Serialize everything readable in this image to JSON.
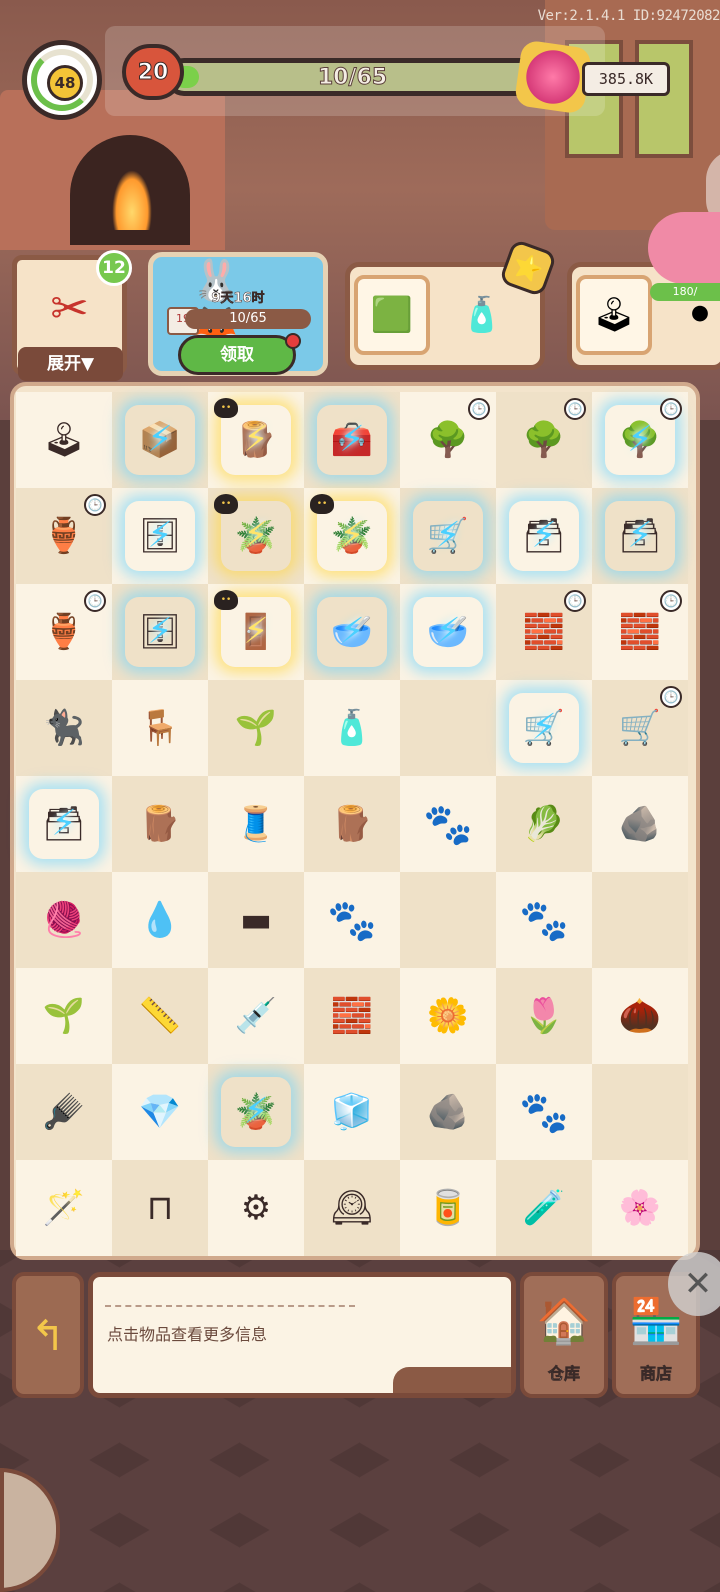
{
  "version_id": "Ver:2.1.4.1 ID:92472082",
  "player": {
    "level": "48",
    "pumpkin_count": "20",
    "xp_text": "10/65",
    "currency": "385.8K",
    "xp_progress": 0.154
  },
  "quest": {
    "badge_count": "12",
    "expand_label": "展开▼"
  },
  "event": {
    "timer": "9天16时",
    "tag": "19",
    "progress_text": "10/65",
    "claim_label": "领取"
  },
  "piggy": {
    "progress_text": "180/"
  },
  "board_rows": [
    [
      {
        "name": "arcade-machine",
        "glyph": "🕹",
        "fx": ""
      },
      {
        "name": "crate-box",
        "glyph": "📦",
        "fx": "energy"
      },
      {
        "name": "wooden-stakes",
        "glyph": "🪵",
        "fx": "gold",
        "cat": "1-13"
      },
      {
        "name": "tool-chest",
        "glyph": "🧰",
        "fx": "energy"
      },
      {
        "name": "bonsai-tree",
        "glyph": "🌳",
        "fx": "",
        "clock": true
      },
      {
        "name": "bonsai-tree",
        "glyph": "🌳",
        "fx": "",
        "clock": true
      },
      {
        "name": "bonsai-tree",
        "glyph": "🌳",
        "fx": "energy",
        "clock": true
      }
    ],
    [
      {
        "name": "blue-vase",
        "glyph": "🏺",
        "fx": "",
        "clock": true
      },
      {
        "name": "glass-cabinet",
        "glyph": "🗄",
        "fx": "energy"
      },
      {
        "name": "plant-pot",
        "glyph": "🪴",
        "fx": "gold",
        "cat": "1-19"
      },
      {
        "name": "plant-pot",
        "glyph": "🪴",
        "fx": "gold",
        "cat": "1-12"
      },
      {
        "name": "mine-cart",
        "glyph": "🛒",
        "fx": "energy"
      },
      {
        "name": "dresser",
        "glyph": "🗃",
        "fx": "energy"
      },
      {
        "name": "dresser-flowers",
        "glyph": "🗃",
        "fx": "energy"
      }
    ],
    [
      {
        "name": "flower-vase",
        "glyph": "🏺",
        "fx": "",
        "clock": true
      },
      {
        "name": "glass-cabinet",
        "glyph": "🗄",
        "fx": "energy"
      },
      {
        "name": "folding-screen",
        "glyph": "🚪",
        "fx": "gold",
        "cat": "1-131"
      },
      {
        "name": "golden-bowl",
        "glyph": "🥣",
        "fx": "energy"
      },
      {
        "name": "glass-bowl",
        "glyph": "🥣",
        "fx": "energy"
      },
      {
        "name": "brick-cart",
        "glyph": "🧱",
        "fx": "",
        "clock": true
      },
      {
        "name": "brick-cart",
        "glyph": "🧱",
        "fx": "",
        "clock": true
      }
    ],
    [
      {
        "name": "black-cat",
        "glyph": "🐈‍⬛",
        "fx": ""
      },
      {
        "name": "side-table",
        "glyph": "🪑",
        "fx": ""
      },
      {
        "name": "berry-plant",
        "glyph": "🌱",
        "fx": ""
      },
      {
        "name": "potion-bottle",
        "glyph": "🧴",
        "fx": ""
      },
      {
        "name": "empty",
        "glyph": "",
        "fx": ""
      },
      {
        "name": "mine-cart",
        "glyph": "🛒",
        "fx": "energy"
      },
      {
        "name": "orange-cart",
        "glyph": "🛒",
        "fx": "",
        "clock": true
      }
    ],
    [
      {
        "name": "drawer-chest",
        "glyph": "🗃",
        "fx": "energy"
      },
      {
        "name": "firewood",
        "glyph": "🪵",
        "fx": ""
      },
      {
        "name": "sewing-kit",
        "glyph": "🧵",
        "fx": ""
      },
      {
        "name": "wood-planks",
        "glyph": "🪵",
        "fx": ""
      },
      {
        "name": "paw-empty",
        "glyph": "🐾",
        "fx": "paw"
      },
      {
        "name": "green-succulent",
        "glyph": "🥬",
        "fx": ""
      },
      {
        "name": "rock",
        "glyph": "🪨",
        "fx": ""
      }
    ],
    [
      {
        "name": "thread-spool",
        "glyph": "🧶",
        "fx": ""
      },
      {
        "name": "dropper-bottle",
        "glyph": "💧",
        "fx": ""
      },
      {
        "name": "iron-bar",
        "glyph": "▬",
        "fx": ""
      },
      {
        "name": "paw-empty",
        "glyph": "🐾",
        "fx": "paw"
      },
      {
        "name": "empty",
        "glyph": "",
        "fx": ""
      },
      {
        "name": "paw-empty",
        "glyph": "🐾",
        "fx": "paw"
      },
      {
        "name": "empty",
        "glyph": "",
        "fx": ""
      }
    ],
    [
      {
        "name": "seedling-box",
        "glyph": "🌱",
        "fx": ""
      },
      {
        "name": "spirit-level",
        "glyph": "📏",
        "fx": ""
      },
      {
        "name": "pipette",
        "glyph": "💉",
        "fx": ""
      },
      {
        "name": "iron-bars",
        "glyph": "🧱",
        "fx": ""
      },
      {
        "name": "blue-flower",
        "glyph": "🌼",
        "fx": ""
      },
      {
        "name": "pink-succulent",
        "glyph": "🌷",
        "fx": ""
      },
      {
        "name": "acorns",
        "glyph": "🌰",
        "fx": ""
      }
    ],
    [
      {
        "name": "comb-tool",
        "glyph": "🪮",
        "fx": ""
      },
      {
        "name": "crystal-sand",
        "glyph": "💎",
        "fx": ""
      },
      {
        "name": "gold-plant-pot",
        "glyph": "🪴",
        "fx": "energy"
      },
      {
        "name": "ice-crystals",
        "glyph": "🧊",
        "fx": ""
      },
      {
        "name": "coal",
        "glyph": "🪨",
        "fx": ""
      },
      {
        "name": "paw-empty",
        "glyph": "🐾",
        "fx": "paw"
      },
      {
        "name": "empty",
        "glyph": "",
        "fx": ""
      }
    ],
    [
      {
        "name": "magic-wand",
        "glyph": "🪄",
        "fx": ""
      },
      {
        "name": "handle",
        "glyph": "⊓",
        "fx": ""
      },
      {
        "name": "button-knob",
        "glyph": "⚙",
        "fx": ""
      },
      {
        "name": "golden-clock",
        "glyph": "🕰",
        "fx": ""
      },
      {
        "name": "paint-can",
        "glyph": "🥫",
        "fx": ""
      },
      {
        "name": "potion-flask",
        "glyph": "🧪",
        "fx": ""
      },
      {
        "name": "potted-tree",
        "glyph": "🌸",
        "fx": ""
      }
    ]
  ],
  "info": {
    "hint": "点击物品查看更多信息"
  },
  "buttons": {
    "warehouse": "仓库",
    "shop": "商店"
  },
  "colors": {
    "accent_green": "#6cc04a",
    "brown_frame": "#7a4a3a",
    "energy_blue": "#4bd0ff"
  }
}
